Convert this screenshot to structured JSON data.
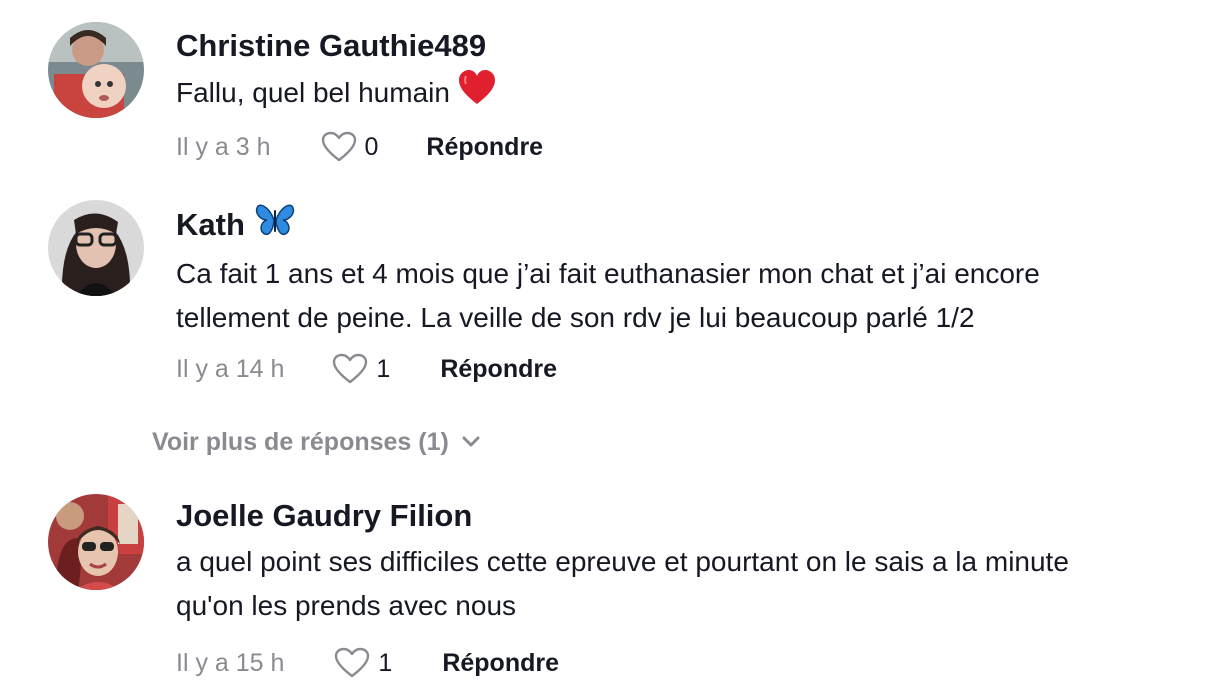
{
  "comments": [
    {
      "username": "Christine Gauthie489",
      "text": "Fallu, quel bel humain",
      "text_emoji": "red-heart",
      "time": "Il y a 3 h",
      "likes": "0",
      "reply_label": "Répondre"
    },
    {
      "username": "Kath",
      "username_emoji": "butterfly",
      "text_line1": "Ca fait 1 ans et 4 mois que j’ai fait euthanasier mon chat et j’ai encore",
      "text_line2": "tellement de peine. La veille de son rdv je lui beaucoup parlé 1/2",
      "time": "Il y a 14 h",
      "likes": "1",
      "reply_label": "Répondre",
      "more_replies": "Voir plus de réponses (1)"
    },
    {
      "username": "Joelle Gaudry Filion",
      "text_line1": "a quel point ses difficiles cette epreuve et pourtant on le sais a la minute",
      "text_line2": "qu'on les prends avec nous",
      "time": "Il y a 15 h",
      "likes": "1",
      "reply_label": "Répondre"
    }
  ],
  "colors": {
    "text": "#161823",
    "muted": "#8a8b91",
    "heart_emoji": "#e0202e",
    "butterfly_emoji": "#2f8be0"
  },
  "icons": [
    "heart-outline-icon",
    "chevron-down-icon",
    "red-heart-emoji",
    "butterfly-emoji"
  ]
}
